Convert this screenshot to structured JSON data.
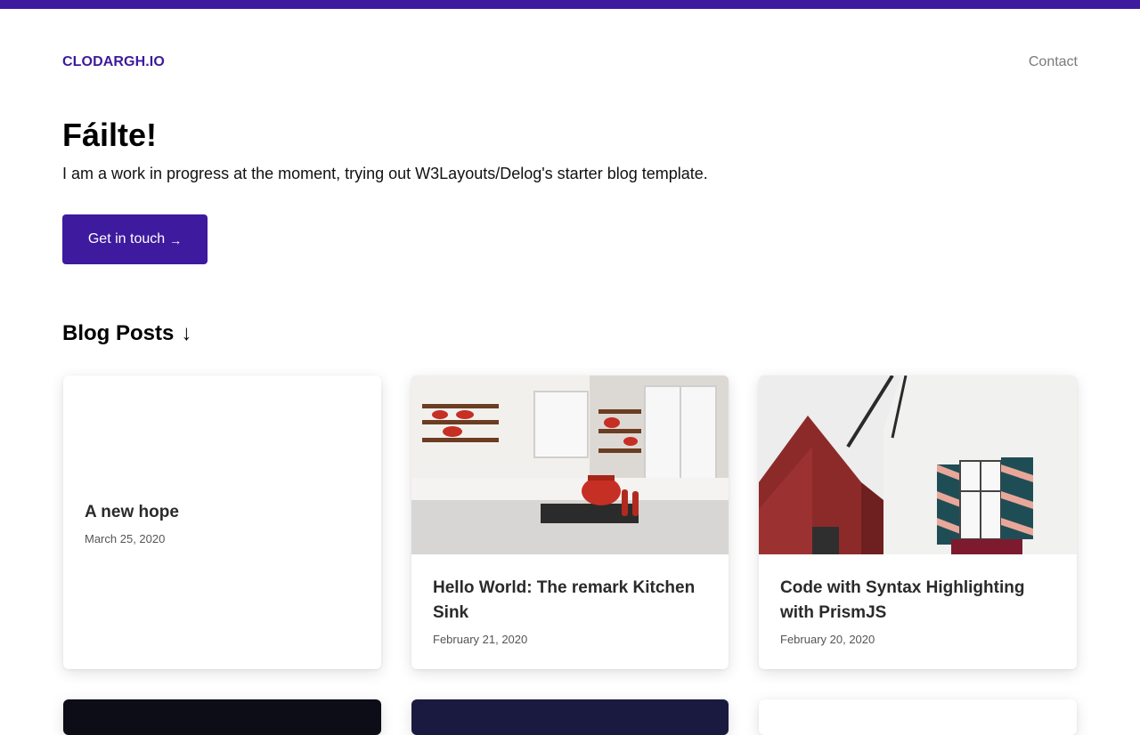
{
  "site": {
    "brand": "CLODARGH.IO",
    "nav": {
      "contact": "Contact"
    }
  },
  "hero": {
    "title": "Fáilte!",
    "subtitle": "I am a work in progress at the moment, trying out W3Layouts/Delog's starter blog template.",
    "cta_label": "Get in touch",
    "cta_arrow": "→"
  },
  "blog": {
    "heading": "Blog Posts",
    "heading_arrow": "↓",
    "posts": [
      {
        "title": "A new hope",
        "date": "March 25, 2020"
      },
      {
        "title": "Hello World: The remark Kitchen Sink",
        "date": "February 21, 2020"
      },
      {
        "title": "Code with Syntax Highlighting with PrismJS",
        "date": "February 20, 2020"
      }
    ]
  },
  "colors": {
    "accent": "#3d1a9e",
    "muted": "#7a7a7a"
  }
}
